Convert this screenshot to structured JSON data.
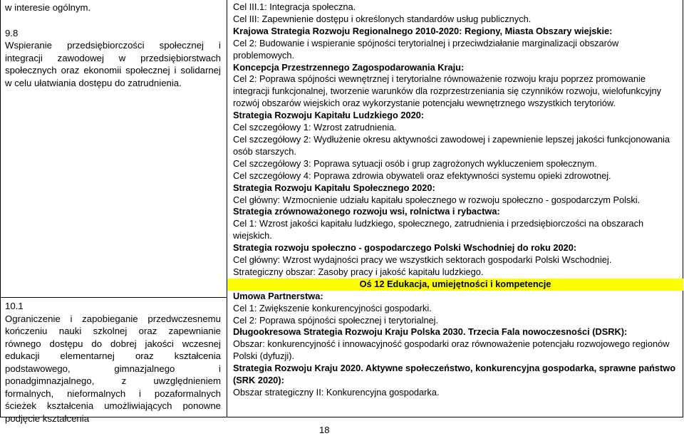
{
  "left": {
    "block1": {
      "lead": "w interesie ogólnym.",
      "code": "9.8",
      "text": "Wspieranie przedsiębiorczości społecznej i integracji zawodowej w przedsiębiorstwach społecznych oraz ekonomii społecznej i solidarnej w celu ułatwiania dostępu do zatrudnienia."
    },
    "block2": {
      "code": "10.1",
      "text": "Ograniczenie i zapobieganie przedwczesnemu kończeniu nauki szkolnej oraz zapewnianie równego dostępu do dobrej jakości wczesnej edukacji elementarnej oraz kształcenia podstawowego, gimnazjalnego i ponadgimnazjalnego, z uwzględnieniem formalnych, nieformalnych i pozaformalnych ścieżek kształcenia umożliwiających ponowne podjęcie kształcenia"
    }
  },
  "right": {
    "lines": [
      {
        "t": "Cel III.1: Integracja społeczna.",
        "b": false
      },
      {
        "t": "Cel III: Zapewnienie dostępu i określonych standardów usług publicznych.",
        "b": false
      },
      {
        "t": "Krajowa Strategia Rozwoju Regionalnego 2010-2020: Regiony, Miasta Obszary wiejskie:",
        "b": true
      },
      {
        "t": "Cel 2: Budowanie i wspieranie spójności terytorialnej i przeciwdziałanie marginalizacji obszarów problemowych.",
        "b": false
      },
      {
        "t": "Koncepcja Przestrzennego Zagospodarowania Kraju:",
        "b": true
      },
      {
        "t": "Cel 2: Poprawa spójności wewnętrznej i terytorialne równoważenie rozwoju kraju poprzez promowanie integracji funkcjonalnej, tworzenie warunków dla rozprzestrzeniania się czynników rozwoju, wielofunkcyjny rozwój obszarów wiejskich oraz wykorzystanie potencjału wewnętrznego wszystkich terytoriów.",
        "b": false
      },
      {
        "t": "Strategia Rozwoju Kapitału Ludzkiego 2020:",
        "b": true
      },
      {
        "t": "Cel szczegółowy 1: Wzrost zatrudnienia.",
        "b": false
      },
      {
        "t": "Cel szczegółowy 2: Wydłużenie okresu aktywności zawodowej i zapewnienie lepszej jakości funkcjonowania osób starszych.",
        "b": false
      },
      {
        "t": "Cel szczegółowy 3: Poprawa sytuacji osób i grup zagrożonych wykluczeniem społecznym.",
        "b": false
      },
      {
        "t": "Cel szczegółowy 4: Poprawa zdrowia obywateli oraz efektywności systemu opieki zdrowotnej.",
        "b": false
      },
      {
        "t": "Strategia Rozwoju Kapitału Społecznego 2020:",
        "b": true
      },
      {
        "t": "Cel główny: Wzmocnienie udziału kapitału społecznego w rozwoju społeczno - gospodarczym Polski.",
        "b": false
      },
      {
        "t": "Strategia zrównoważonego rozwoju wsi, rolnictwa i rybactwa:",
        "b": true
      },
      {
        "t": "Cel 1: Wzrost jakości kapitału ludzkiego, społecznego, zatrudnienia i przedsiębiorczości na obszarach wiejskich.",
        "b": false
      },
      {
        "t": "Strategia rozwoju społeczno - gospodarczego Polski Wschodniej do roku 2020:",
        "b": true
      },
      {
        "t": "Cel główny: Wzrost wydajności pracy we wszystkich sektorach gospodarki Polski Wschodniej.",
        "b": false
      },
      {
        "t": "Strategiczny obszar: Zasoby pracy i jakość kapitału ludzkiego.",
        "b": false
      }
    ],
    "axis_title": "Oś 12 Edukacja, umiejętności i kompetencje",
    "lines2": [
      {
        "t": "Umowa Partnerstwa:",
        "b": true
      },
      {
        "t": "Cel 1: Zwiększenie konkurencyjności gospodarki.",
        "b": false
      },
      {
        "t": "Cel 2: Poprawa spójności społecznej i terytorialnej.",
        "b": false
      },
      {
        "t": "Długookresowa Strategia Rozwoju Kraju Polska 2030. Trzecia Fala nowoczesności (DSRK):",
        "b": true
      },
      {
        "t": "Obszar: konkurencyjność i innowacyjność gospodarki oraz równoważenie potencjału rozwojowego regionów Polski (dyfuzji).",
        "b": false
      },
      {
        "t": "Strategia Rozwoju Kraju 2020. Aktywne społeczeństwo, konkurencyjna gospodarka, sprawne państwo (SRK 2020):",
        "b": true
      },
      {
        "t": "Obszar strategiczny II: Konkurencyjna gospodarka.",
        "b": false
      }
    ]
  },
  "page_number": "18",
  "colors": {
    "highlight": "#ffff00",
    "rule": "#000000"
  }
}
